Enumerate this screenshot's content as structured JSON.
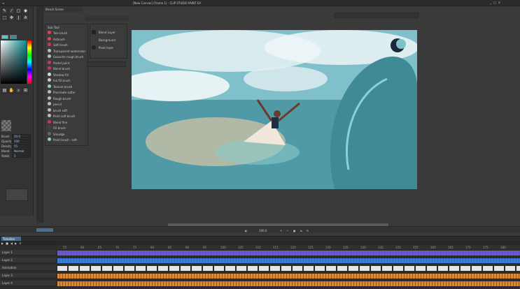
{
  "app": {
    "title": "[New Canvas] (Frame 1) - CLIP STUDIO PAINT EX",
    "canvas_tab": "Beach Scene"
  },
  "colors": {
    "accent_teal": "#5fc7c0",
    "track_purple": "#6b5bd0",
    "track_blue": "#3d7fd8",
    "track_orange": "#d98a3a",
    "timeline_tab": "#4a6e91"
  },
  "toolbox": {
    "tool_icons": [
      "pen-icon",
      "brush-icon",
      "eraser-icon",
      "fill-icon",
      "gradient-icon",
      "selection-icon",
      "move-icon",
      "eyedropper-icon",
      "text-icon",
      "hand-icon",
      "zoom-icon",
      "ruler-icon"
    ],
    "property_rows": [
      {
        "label": "Brush",
        "value": "20.0"
      },
      {
        "label": "Opacity",
        "value": "100"
      },
      {
        "label": "Density",
        "value": "55"
      },
      {
        "label": "Blend",
        "value": "Normal"
      },
      {
        "label": "Stabil.",
        "value": "5"
      }
    ]
  },
  "brush_panel": {
    "title": "Sub Tool",
    "items": [
      {
        "name": "Tele brush",
        "color": "#d8475a"
      },
      {
        "name": "Airbrush",
        "color": "#d8475a"
      },
      {
        "name": "Soft brush",
        "color": "#c73b54"
      },
      {
        "name": "Transparent watercolor",
        "color": "#bbbbbb"
      },
      {
        "name": "Gouache rough brush",
        "color": "#bbbbbb"
      },
      {
        "name": "Pastel paint",
        "color": "#c73b54"
      },
      {
        "name": "Blend brush",
        "color": "#c73b54"
      },
      {
        "name": "Shadow fill",
        "color": "#dddddd"
      },
      {
        "name": "Ink fill brush",
        "color": "#cccccc"
      },
      {
        "name": "Texture brush",
        "color": "#8fd0c8"
      },
      {
        "name": "Procreate softer",
        "color": "#bbbbbb"
      },
      {
        "name": "Rough brush",
        "color": "#bbbbbb"
      },
      {
        "name": "pencil",
        "color": "#bbbbbb"
      },
      {
        "name": "brush soft",
        "color": "#bbbbbb"
      },
      {
        "name": "Paint soft brush",
        "color": "#bbbbbb"
      },
      {
        "name": "Blend fine",
        "color": "#c73b54"
      },
      {
        "name": "Fill brush",
        "color": "#444444"
      },
      {
        "name": "Smudge",
        "color": "#666666"
      },
      {
        "name": "Paint brush - soft",
        "color": "#8fd0c8"
      }
    ]
  },
  "layer_panel": {
    "rows": [
      "Blend Layer",
      "Background",
      "Paint layer"
    ]
  },
  "navigator": {
    "zoom": "100.0"
  },
  "timeline": {
    "tab_label": "Timeline",
    "tracks": [
      {
        "label": "Layer 1",
        "color": "#6b5bd0"
      },
      {
        "label": "Layer 2",
        "color": "#3d7fd8"
      },
      {
        "label": "Animation",
        "color": "#dddddd"
      },
      {
        "label": "Layer 3",
        "color": "#d98a3a"
      },
      {
        "label": "Layer 4",
        "color": "#d98a3a"
      }
    ],
    "ruler_marks": [
      "55",
      "60",
      "65",
      "70",
      "75",
      "80",
      "85",
      "90",
      "95",
      "100",
      "105",
      "110",
      "115",
      "120",
      "125",
      "130",
      "135",
      "140",
      "145",
      "150",
      "155",
      "160",
      "165",
      "170",
      "175",
      "180"
    ]
  }
}
